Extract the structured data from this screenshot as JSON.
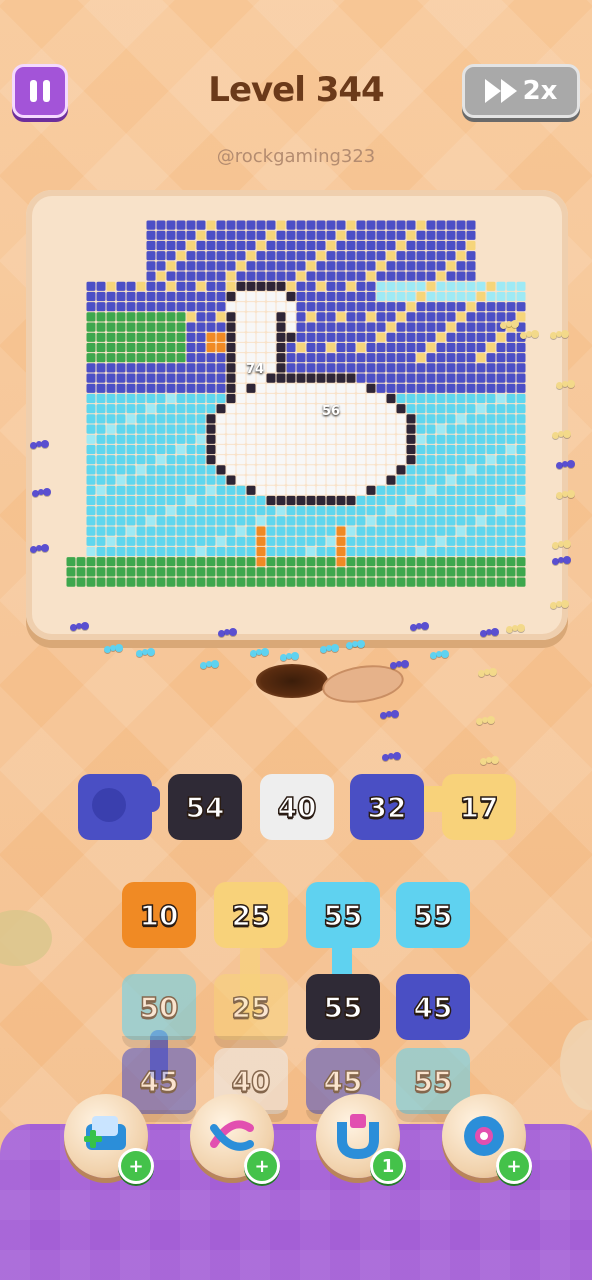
{
  "header": {
    "level_title": "Level 344",
    "speed_label": "2x",
    "watermark": "@rockgaming323"
  },
  "board": {
    "picture": "pixel-art goose",
    "markers": [
      "74",
      "56"
    ]
  },
  "queue": {
    "slots": [
      {
        "label": "",
        "color": "#4a4fc4"
      },
      {
        "label": "54",
        "color": "#2f2a36"
      },
      {
        "label": "40",
        "color": "#eeeeee"
      },
      {
        "label": "32",
        "color": "#4a4fc4"
      },
      {
        "label": "17",
        "color": "#f8d27a"
      }
    ]
  },
  "grid": {
    "rows": [
      [
        {
          "label": "10",
          "color": "#f08a24",
          "faded": false
        },
        {
          "label": "25",
          "color": "#f8d27a",
          "faded": false
        },
        {
          "label": "55",
          "color": "#5fd2f0",
          "faded": false
        },
        {
          "label": "55",
          "color": "#5fd2f0",
          "faded": false
        }
      ],
      [
        {
          "label": "50",
          "color": "#5fd2f0",
          "faded": true
        },
        {
          "label": "25",
          "color": "#f8d27a",
          "faded": true
        },
        {
          "label": "55",
          "color": "#2f2a36",
          "faded": false
        },
        {
          "label": "45",
          "color": "#4a4fc4",
          "faded": false
        }
      ],
      [
        {
          "label": "45",
          "color": "#4a4fc4",
          "faded": true
        },
        {
          "label": "40",
          "color": "#eeeeee",
          "faded": true
        },
        {
          "label": "45",
          "color": "#4a4fc4",
          "faded": true
        },
        {
          "label": "55",
          "color": "#5fd2f0",
          "faded": true
        }
      ]
    ]
  },
  "boosters": [
    {
      "name": "add-slot",
      "badge": "+"
    },
    {
      "name": "shuffle",
      "badge": "+"
    },
    {
      "name": "magnet",
      "badge": "1"
    },
    {
      "name": "tape",
      "badge": "+"
    }
  ]
}
